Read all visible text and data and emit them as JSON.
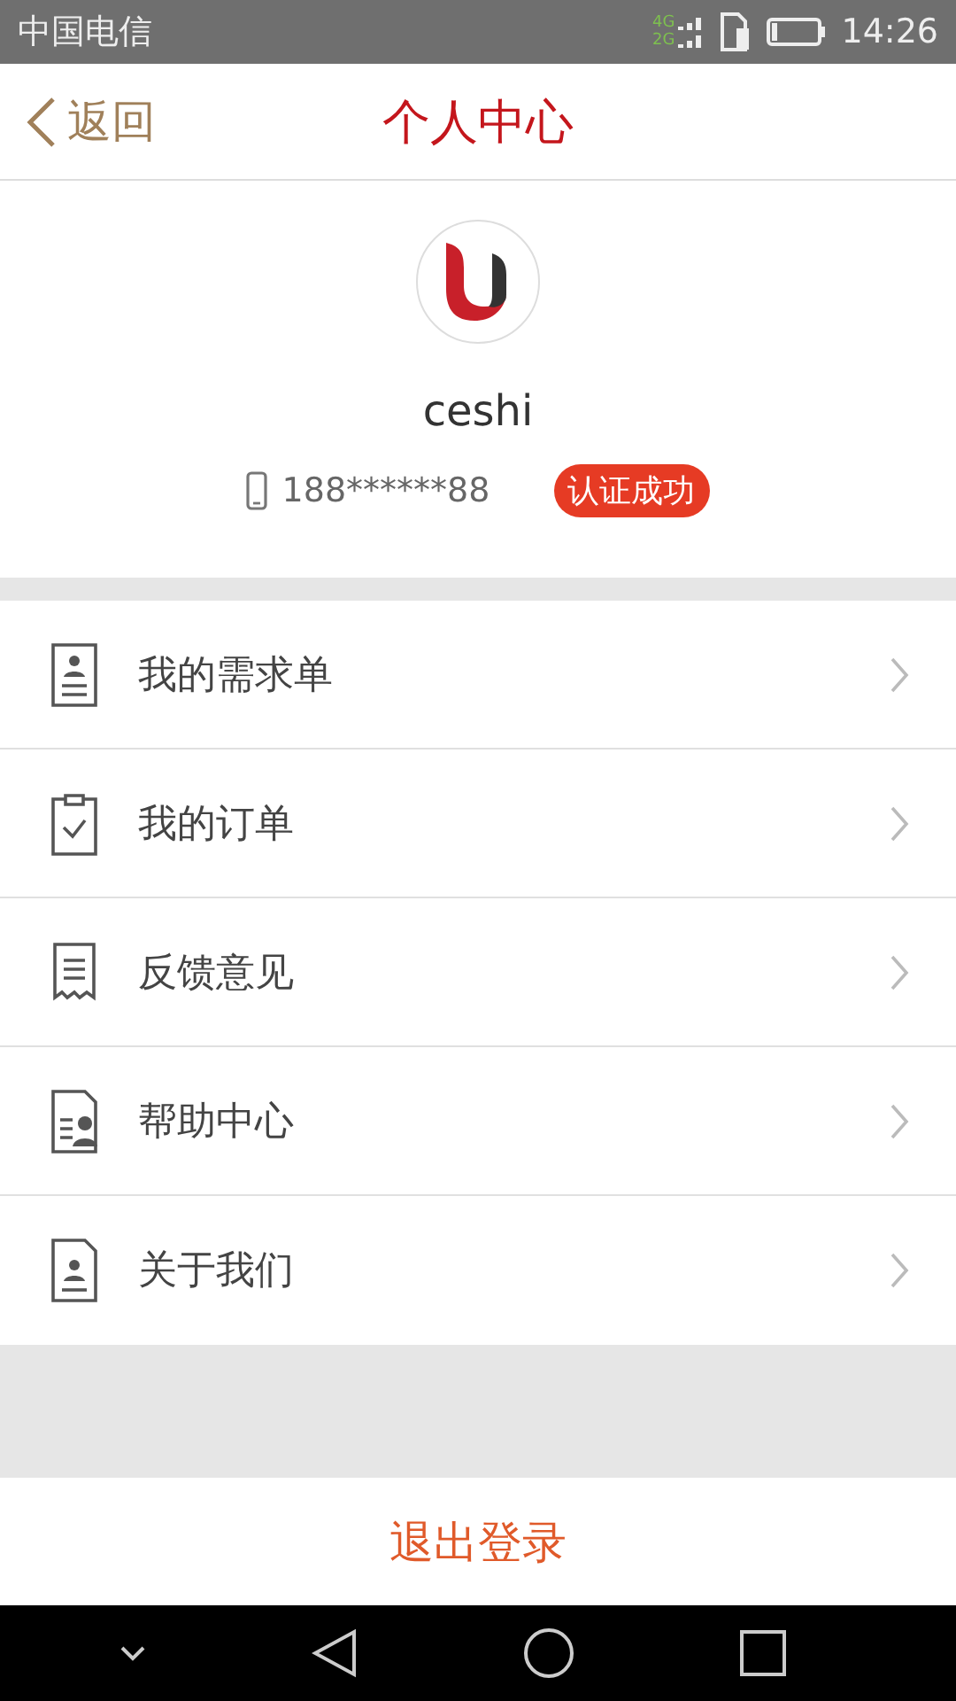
{
  "status_bar": {
    "carrier": "中国电信",
    "network_top": "4G",
    "network_bottom": "2G",
    "time": "14:26"
  },
  "nav": {
    "back": "返回",
    "title": "个人中心"
  },
  "profile": {
    "name": "ceshi",
    "phone": "188******88",
    "badge": "认证成功"
  },
  "menu": [
    {
      "kind": "request",
      "label": "我的需求单"
    },
    {
      "kind": "order",
      "label": "我的订单"
    },
    {
      "kind": "feedback",
      "label": "反馈意见"
    },
    {
      "kind": "help",
      "label": "帮助中心"
    },
    {
      "kind": "about",
      "label": "关于我们"
    }
  ],
  "logout": "退出登录"
}
